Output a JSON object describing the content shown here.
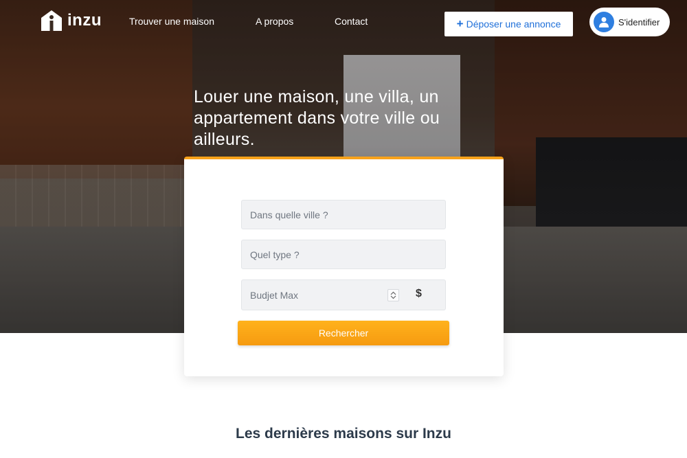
{
  "brand": {
    "name": "inzu"
  },
  "nav": {
    "links": [
      "Trouver une maison",
      "A propos",
      "Contact"
    ],
    "post_button": "Déposer une annonce",
    "signin": "S'identifier"
  },
  "hero": {
    "headline": "Louer une maison, une villa, un appartement dans votre ville ou ailleurs."
  },
  "search": {
    "city_placeholder": "Dans quelle ville ?",
    "type_placeholder": "Quel type ?",
    "budget_placeholder": "Budjet Max",
    "currency_symbol": "$",
    "submit_label": "Rechercher"
  },
  "latest": {
    "title": "Les dernières maisons sur Inzu"
  },
  "colors": {
    "accent": "#f7a21b",
    "primary": "#1e6fd9"
  },
  "icons": {
    "logo": "house-i-icon",
    "plus": "plus-icon",
    "user": "user-icon",
    "stepper": "up-down-icon"
  }
}
